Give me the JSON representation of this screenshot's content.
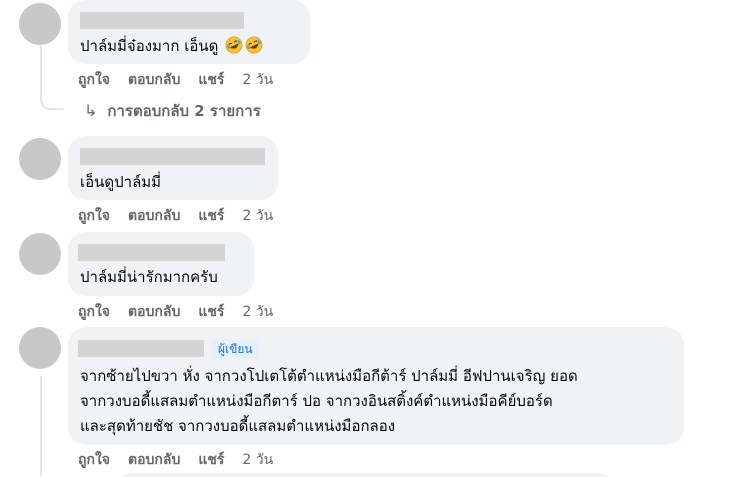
{
  "actions": {
    "like": "ถูกใจ",
    "reply": "ตอบกลับ",
    "share": "แชร์",
    "time": "2 วัน"
  },
  "comments": [
    {
      "text": "ปาล์มมี่จ๋องมาก เอ็นดู",
      "emojis": [
        "rolling-laughing-emoji",
        "rolling-laughing-emoji"
      ],
      "replies_link": "การตอบกลับ 2 รายการ"
    },
    {
      "text": "เอ็นดูปาล์มมี่"
    },
    {
      "text": "ปาล์มมี่น่ารักมากครับ"
    },
    {
      "badge": "ผู้เขียน",
      "lines": [
        "จากซ้ายไปขวา หั่ง จากวงโปเตโต้ตำแหน่งมือกีต้าร์ ปาล์มมี่ อีฟปานเจริญ ยอด",
        "จากวงบอดี้แสลมตำแหน่งมือกีตาร์ ปอ จากวงอินสติ้งค์ตำแหน่งมือคีย์บอร์ด",
        "และสุดท้ายชัช จากวงบอดี้แสลมตำแหน่งมือกลอง"
      ]
    }
  ],
  "colors": {
    "bubble_bg": "#f0f2f5",
    "avatar_placeholder": "#c8c8c8",
    "name_redaction": "#d4d4d4",
    "action_text": "#65676b",
    "badge_bg": "#e7f0fd",
    "badge_text": "#1b74e4"
  }
}
